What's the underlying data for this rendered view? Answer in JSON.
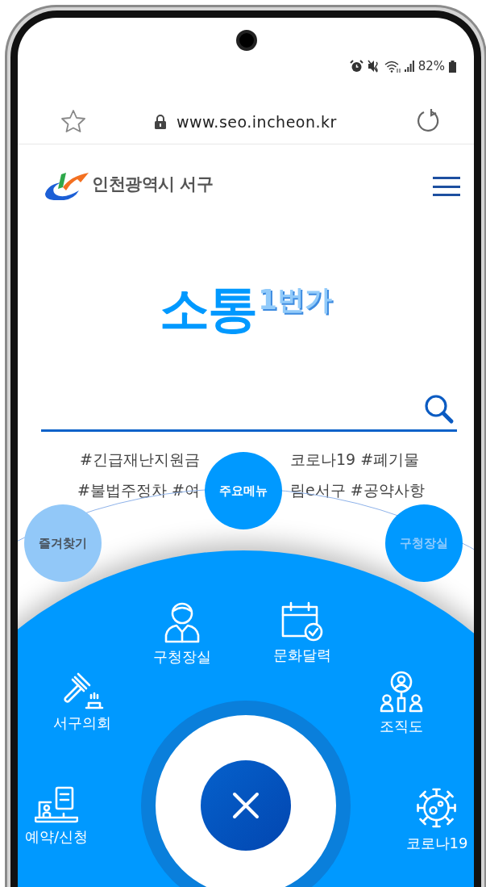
{
  "status_bar": {
    "battery": "82%"
  },
  "browser": {
    "url": "www.seo.incheon.kr"
  },
  "header": {
    "logo_text": "인천광역시 서구"
  },
  "banner": {
    "title_main": "소통",
    "title_sub": "1번가"
  },
  "hashtags": [
    [
      "#긴급재난지원금",
      "코로나19 #폐기물"
    ],
    [
      "#불법주정차 #여",
      "림e서구 #공약사항"
    ]
  ],
  "orbit_buttons": [
    {
      "label": "즐겨찾기",
      "kind": "light"
    },
    {
      "label": "주요메뉴",
      "kind": "primary"
    },
    {
      "label": "구청장실",
      "kind": "dim"
    }
  ],
  "menu_items": [
    {
      "label": "구청장실",
      "kind": "person"
    },
    {
      "label": "문화달력",
      "kind": "calendar"
    },
    {
      "label": "서구의회",
      "kind": "gavel"
    },
    {
      "label": "조직도",
      "kind": "org"
    },
    {
      "label": "예약/신청",
      "kind": "laptop"
    },
    {
      "label": "코로나19",
      "kind": "virus"
    }
  ]
}
